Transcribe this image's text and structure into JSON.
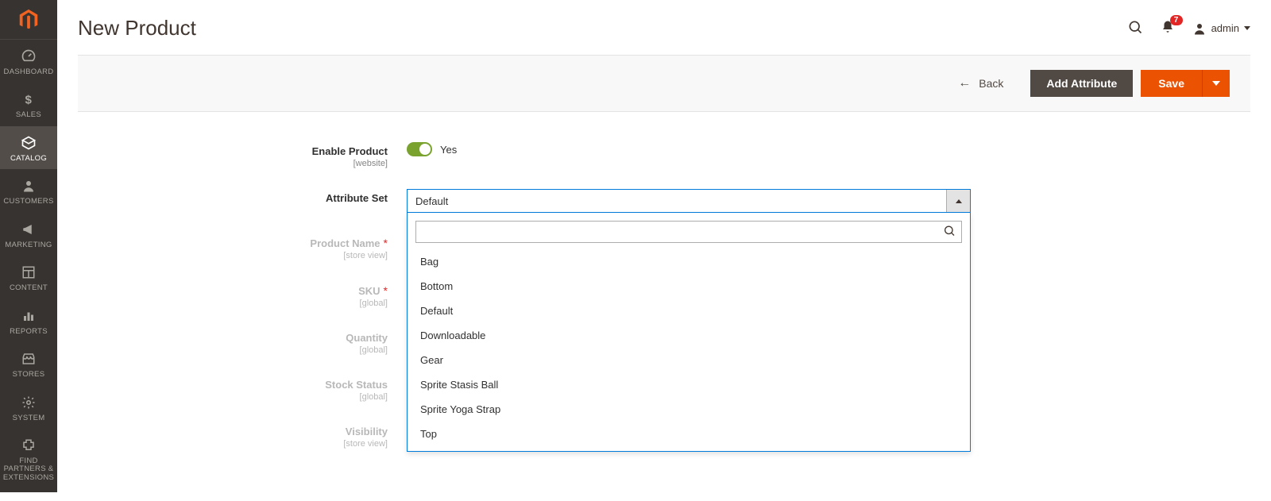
{
  "sidebar": {
    "items": [
      {
        "label": "DASHBOARD"
      },
      {
        "label": "SALES"
      },
      {
        "label": "CATALOG"
      },
      {
        "label": "CUSTOMERS"
      },
      {
        "label": "MARKETING"
      },
      {
        "label": "CONTENT"
      },
      {
        "label": "REPORTS"
      },
      {
        "label": "STORES"
      },
      {
        "label": "SYSTEM"
      },
      {
        "label": "FIND PARTNERS & EXTENSIONS"
      }
    ]
  },
  "header": {
    "title": "New Product",
    "notif_count": "7",
    "user_label": "admin"
  },
  "action_bar": {
    "back_label": "Back",
    "add_attribute_label": "Add Attribute",
    "save_label": "Save"
  },
  "form": {
    "enable_product": {
      "label": "Enable Product",
      "scope": "[website]",
      "value_text": "Yes"
    },
    "attribute_set": {
      "label": "Attribute Set",
      "selected": "Default",
      "search_placeholder": "",
      "options": [
        "Bag",
        "Bottom",
        "Default",
        "Downloadable",
        "Gear",
        "Sprite Stasis Ball",
        "Sprite Yoga Strap",
        "Top"
      ]
    },
    "product_name": {
      "label": "Product Name",
      "scope": "[store view]"
    },
    "sku": {
      "label": "SKU",
      "scope": "[global]"
    },
    "quantity": {
      "label": "Quantity",
      "scope": "[global]"
    },
    "stock_status": {
      "label": "Stock Status",
      "scope": "[global]"
    },
    "visibility": {
      "label": "Visibility",
      "scope": "[store view]"
    }
  }
}
